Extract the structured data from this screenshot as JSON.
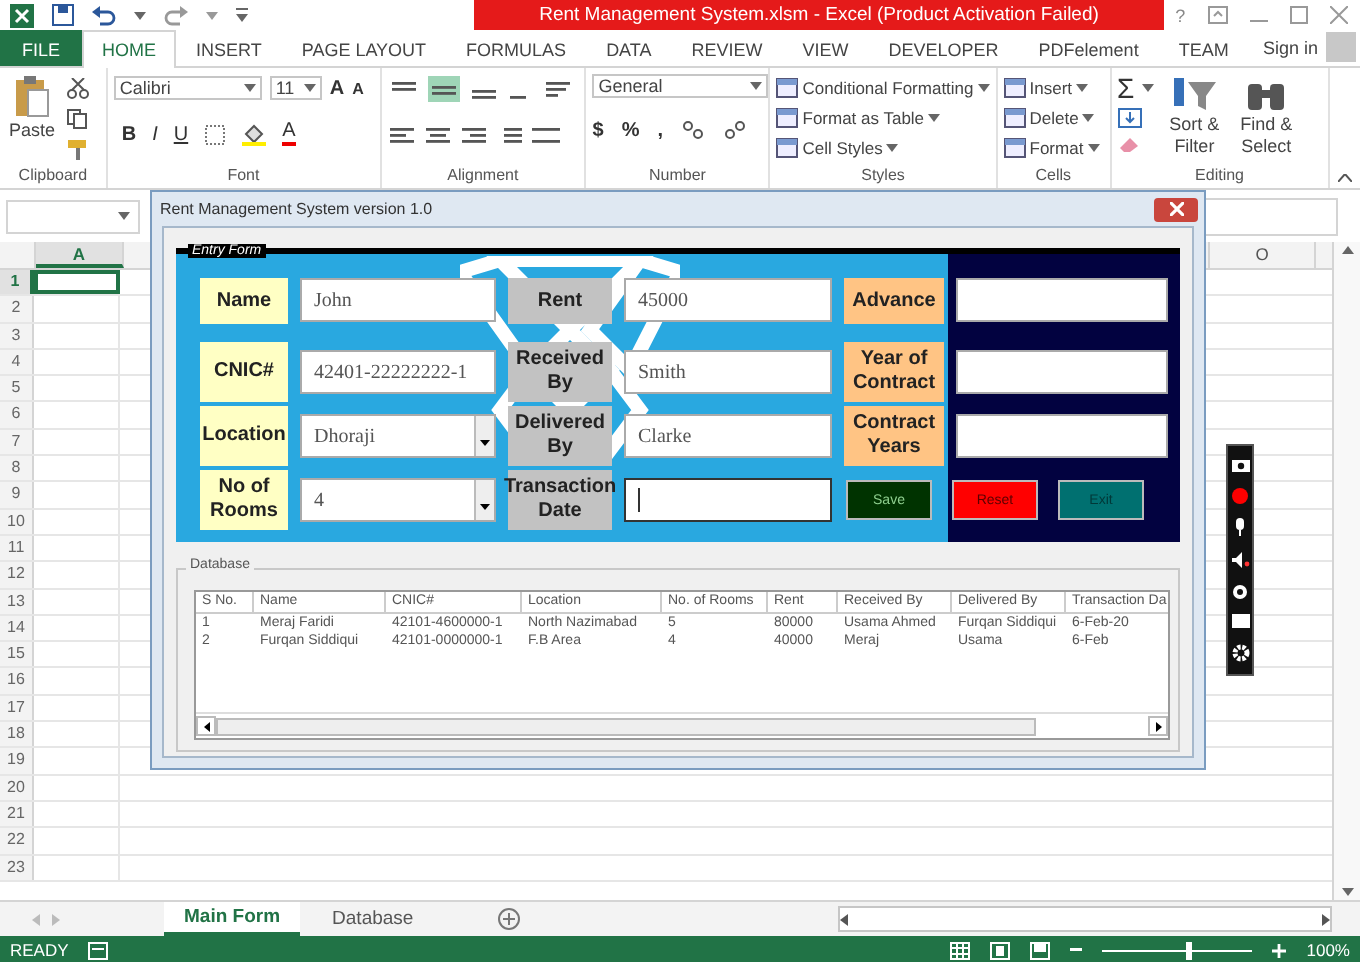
{
  "title_bar": {
    "title": "Rent Management System.xlsm -  Excel (Product Activation Failed)",
    "help": "?"
  },
  "ribbon_tabs": [
    {
      "label": "FILE",
      "kind": "file",
      "selected": false
    },
    {
      "label": "HOME",
      "kind": "tab",
      "selected": true
    },
    {
      "label": "INSERT",
      "kind": "tab",
      "selected": false
    },
    {
      "label": "PAGE LAYOUT",
      "kind": "tab",
      "selected": false
    },
    {
      "label": "FORMULAS",
      "kind": "tab",
      "selected": false
    },
    {
      "label": "DATA",
      "kind": "tab",
      "selected": false
    },
    {
      "label": "REVIEW",
      "kind": "tab",
      "selected": false
    },
    {
      "label": "VIEW",
      "kind": "tab",
      "selected": false
    },
    {
      "label": "DEVELOPER",
      "kind": "tab",
      "selected": false
    },
    {
      "label": "PDFelement",
      "kind": "tab",
      "selected": false
    },
    {
      "label": "TEAM",
      "kind": "tab",
      "selected": false
    }
  ],
  "sign_in": "Sign in",
  "ribbon_groups": [
    {
      "kind": "clipboard",
      "label": "Clipboard",
      "paste": "Paste"
    },
    {
      "kind": "font",
      "label": "Font",
      "font_name": "Calibri",
      "font_size": "11",
      "grow": "A",
      "shrink": "A",
      "styles": [
        "B",
        "I",
        "U"
      ],
      "color_glyph": "A"
    },
    {
      "kind": "alignment",
      "label": "Alignment",
      "vertical_aligns": [
        {
          "selected": false
        },
        {
          "selected": true
        },
        {
          "selected": false
        }
      ]
    },
    {
      "kind": "number",
      "label": "Number",
      "format": "General",
      "symbols": [
        "$",
        "%",
        ","
      ]
    },
    {
      "kind": "styles",
      "label": "Styles",
      "commands": [
        "Conditional Formatting",
        "Format as Table",
        "Cell Styles"
      ]
    },
    {
      "kind": "cells",
      "label": "Cells",
      "commands": [
        "Insert",
        "Delete",
        "Format"
      ]
    },
    {
      "kind": "editing",
      "label": "Editing",
      "sum": "Σ",
      "commands": [
        "Sort & Filter",
        "Find & Select"
      ]
    }
  ],
  "sheet": {
    "columns": [
      {
        "label": "A",
        "selected": true
      },
      {
        "label": "O",
        "selected": false
      }
    ],
    "rows": [
      {
        "label": "1",
        "selected": true
      },
      {
        "label": "2",
        "selected": false
      },
      {
        "label": "3",
        "selected": false
      },
      {
        "label": "4",
        "selected": false
      },
      {
        "label": "5",
        "selected": false
      },
      {
        "label": "6",
        "selected": false
      },
      {
        "label": "7",
        "selected": false
      },
      {
        "label": "8",
        "selected": false
      },
      {
        "label": "9",
        "selected": false
      },
      {
        "label": "10",
        "selected": false
      },
      {
        "label": "11",
        "selected": false
      },
      {
        "label": "12",
        "selected": false
      },
      {
        "label": "13",
        "selected": false
      },
      {
        "label": "14",
        "selected": false
      },
      {
        "label": "15",
        "selected": false
      },
      {
        "label": "16",
        "selected": false
      },
      {
        "label": "17",
        "selected": false
      },
      {
        "label": "18",
        "selected": false
      },
      {
        "label": "19",
        "selected": false
      },
      {
        "label": "20",
        "selected": false
      },
      {
        "label": "21",
        "selected": false
      },
      {
        "label": "22",
        "selected": false
      },
      {
        "label": "23",
        "selected": false
      }
    ]
  },
  "sheet_tabs": [
    {
      "label": "Main Form",
      "selected": true
    },
    {
      "label": "Database",
      "selected": false
    }
  ],
  "status_bar": {
    "mode": "READY",
    "zoom": "100%",
    "level": 0.55
  },
  "dialog": {
    "title": "Rent Management System version 1.0",
    "entry_form": {
      "title": "Entry Form",
      "rows": [
        [
          {
            "label": "Name",
            "color": "#ffffc4",
            "kind": "text",
            "value": "John",
            "focused": false
          },
          {
            "label": "Rent",
            "color": "#c2c2c2",
            "kind": "text",
            "value": "45000",
            "focused": false
          },
          {
            "label": "Advance",
            "color": "#ffc484",
            "kind": "text",
            "focused": false
          }
        ],
        [
          {
            "label": "CNIC#",
            "color": "#ffffc4",
            "kind": "text",
            "value": "42401-22222222-1",
            "focused": false
          },
          {
            "label": "Received By",
            "color": "#c2c2c2",
            "kind": "text",
            "value": "Smith",
            "focused": false
          },
          {
            "label": "Year of Contract",
            "color": "#ffc484",
            "kind": "text",
            "focused": false
          }
        ],
        [
          {
            "label": "Location",
            "color": "#ffffc4",
            "kind": "dropdown",
            "value": "Dhoraji",
            "focused": false
          },
          {
            "label": "Delivered By",
            "color": "#c2c2c2",
            "kind": "text",
            "value": "Clarke",
            "focused": false
          },
          {
            "label": "Contract Years",
            "color": "#ffc484",
            "kind": "text",
            "focused": false
          }
        ],
        [
          {
            "label": "No of Rooms",
            "color": "#ffffc4",
            "kind": "dropdown",
            "value": "4",
            "focused": false
          },
          {
            "label": "Transaction Date",
            "color": "#c2c2c2",
            "kind": "text",
            "focused": true
          }
        ]
      ],
      "buttons": [
        {
          "label": "Save",
          "kind": "save"
        },
        {
          "label": "Reset",
          "kind": "reset"
        },
        {
          "label": "Exit",
          "kind": "exit"
        }
      ]
    },
    "database": {
      "title": "Database",
      "columns": [
        "S No.",
        "Name",
        "CNIC#",
        "Location",
        "No. of Rooms",
        "Rent",
        "Received By",
        "Delivered By",
        "Transaction Da"
      ],
      "rows": [
        [
          "1",
          "Meraj Faridi",
          "42101-4600000-1",
          "North Nazimabad",
          "5",
          "80000",
          "Usama Ahmed",
          "Furqan Siddiqui",
          "6-Feb-20"
        ],
        [
          "2",
          "Furqan Siddiqui",
          "42101-0000000-1",
          "F.B Area",
          "4",
          "40000",
          "Meraj",
          "Usama",
          "6-Feb"
        ]
      ]
    }
  }
}
